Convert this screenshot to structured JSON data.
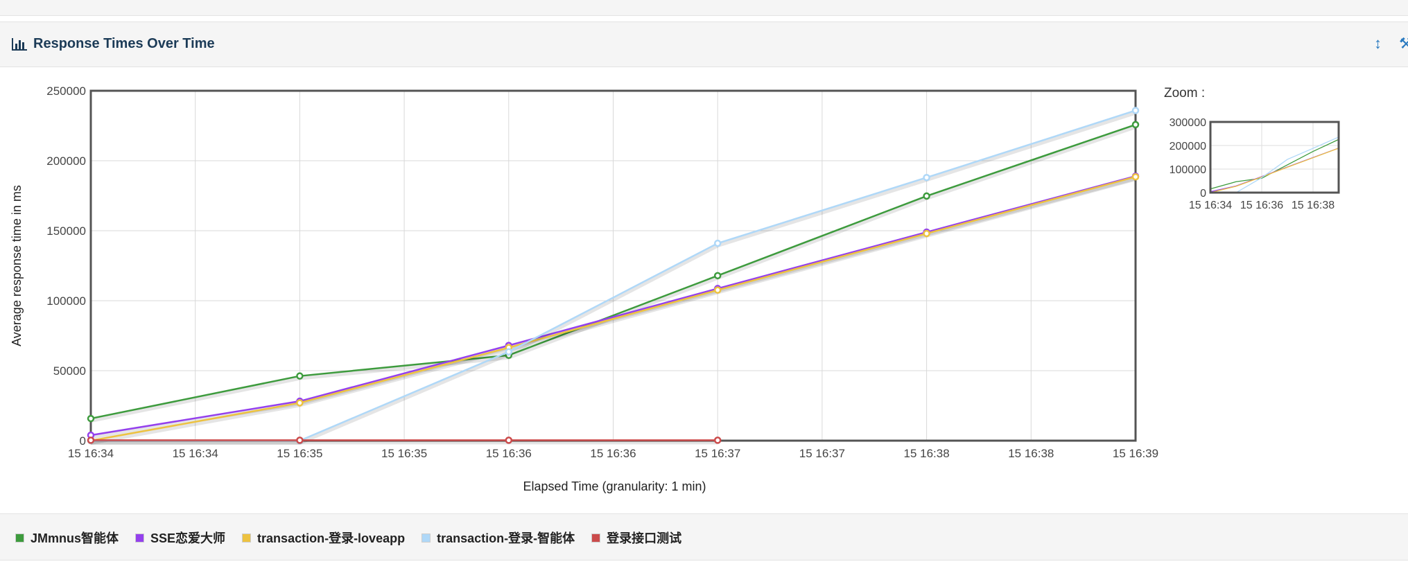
{
  "panel": {
    "title": "Response Times Over Time",
    "tools": [
      "resize-vertical-icon",
      "wrench-icon"
    ]
  },
  "zoom": {
    "label": "Zoom :",
    "y_ticks": [
      "300000",
      "200000",
      "100000",
      "0"
    ],
    "x_ticks": [
      "15 16:34",
      "15 16:36",
      "15 16:38"
    ]
  },
  "chart_data": {
    "type": "line",
    "title": "",
    "xlabel": "Elapsed Time (granularity: 1 min)",
    "ylabel": "Average response time in ms",
    "x_tick_labels": [
      "15 16:34",
      "15 16:34",
      "15 16:35",
      "15 16:35",
      "15 16:36",
      "15 16:36",
      "15 16:37",
      "15 16:37",
      "15 16:38",
      "15 16:38",
      "15 16:39"
    ],
    "y_tick_labels": [
      "0",
      "50000",
      "100000",
      "150000",
      "200000",
      "250000"
    ],
    "ylim": [
      0,
      250000
    ],
    "x_minutes": [
      "15 16:34",
      "15 16:35",
      "15 16:36",
      "15 16:37",
      "15 16:38",
      "15 16:39"
    ],
    "grid": true,
    "legend_position": "bottom",
    "series": [
      {
        "name": "JMmnus智能体",
        "color": "#3d9b3d",
        "points": [
          [
            "15 16:34",
            15800
          ],
          [
            "15 16:35",
            46200
          ],
          [
            "15 16:36",
            61000
          ],
          [
            "15 16:37",
            117900
          ],
          [
            "15 16:38",
            174800
          ],
          [
            "15 16:39",
            225800
          ]
        ]
      },
      {
        "name": "SSE恋爱大师",
        "color": "#9440ed",
        "points": [
          [
            "15 16:34",
            3900
          ],
          [
            "15 16:35",
            28200
          ],
          [
            "15 16:36",
            68000
          ],
          [
            "15 16:37",
            108700
          ],
          [
            "15 16:38",
            149000
          ],
          [
            "15 16:39",
            189000
          ]
        ]
      },
      {
        "name": "transaction-登录-loveapp",
        "color": "#edc240",
        "points": [
          [
            "15 16:34",
            0
          ],
          [
            "15 16:35",
            27000
          ],
          [
            "15 16:36",
            66500
          ],
          [
            "15 16:37",
            107600
          ],
          [
            "15 16:38",
            148000
          ],
          [
            "15 16:39",
            188500
          ]
        ]
      },
      {
        "name": "transaction-登录-智能体",
        "color": "#afd8f8",
        "points": [
          [
            "15 16:34",
            0
          ],
          [
            "15 16:35",
            0
          ],
          [
            "15 16:36",
            63500
          ],
          [
            "15 16:37",
            141000
          ],
          [
            "15 16:38",
            188000
          ],
          [
            "15 16:39",
            235900
          ]
        ]
      },
      {
        "name": "登录接口测试",
        "color": "#cb4b4b",
        "points": [
          [
            "15 16:34",
            300
          ],
          [
            "15 16:35",
            300
          ],
          [
            "15 16:36",
            300
          ],
          [
            "15 16:37",
            300
          ]
        ]
      }
    ]
  }
}
